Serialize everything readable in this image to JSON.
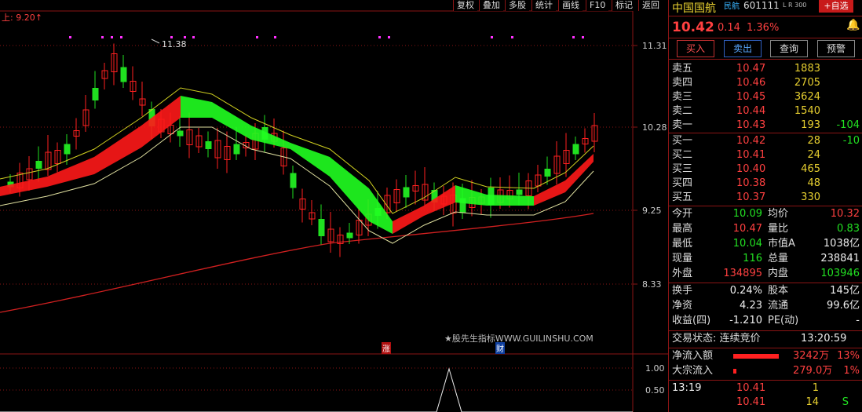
{
  "toolbar": {
    "items": [
      "复权",
      "叠加",
      "多股",
      "统计",
      "画线",
      "F10",
      "标记",
      "返回"
    ]
  },
  "chart_header": {
    "label": "上: 9.20",
    "arrow": "↑"
  },
  "chart_data": {
    "type": "line",
    "yticks": [
      "11.31",
      "10.28",
      "9.25",
      "8.33"
    ],
    "subticks": [
      "1.00",
      "0.50"
    ],
    "high_annotation": "11.38",
    "markers": {
      "zhang": "涨",
      "cai": "财"
    },
    "colors": {
      "up": "#ff2020",
      "down": "#20e020",
      "ma": "#d0d020",
      "long_ma": "#d02020"
    }
  },
  "watermark": "★股先生指标WWW.GUILINSHU.COM",
  "stock": {
    "name": "中国国航",
    "badge": "民航",
    "code": "601111",
    "lr": "L R 300",
    "add_button": "+自选",
    "price": "10.42",
    "change": "0.14",
    "pct": "1.36%",
    "bell_icon": "bell-icon"
  },
  "actions": {
    "buy": "买入",
    "sell": "卖出",
    "query": "查询",
    "alert": "预警"
  },
  "asks": [
    {
      "label": "卖五",
      "price": "10.47",
      "vol": "1883",
      "diff": ""
    },
    {
      "label": "卖四",
      "price": "10.46",
      "vol": "2705",
      "diff": ""
    },
    {
      "label": "卖三",
      "price": "10.45",
      "vol": "3624",
      "diff": ""
    },
    {
      "label": "卖二",
      "price": "10.44",
      "vol": "1540",
      "diff": ""
    },
    {
      "label": "卖一",
      "price": "10.43",
      "vol": "193",
      "diff": "-104"
    }
  ],
  "bids": [
    {
      "label": "买一",
      "price": "10.42",
      "vol": "28",
      "diff": "-10"
    },
    {
      "label": "买二",
      "price": "10.41",
      "vol": "24",
      "diff": ""
    },
    {
      "label": "买三",
      "price": "10.40",
      "vol": "465",
      "diff": ""
    },
    {
      "label": "买四",
      "price": "10.38",
      "vol": "48",
      "diff": ""
    },
    {
      "label": "买五",
      "price": "10.37",
      "vol": "330",
      "diff": ""
    }
  ],
  "stats": [
    {
      "l1": "今开",
      "v1": "10.09",
      "c1": "grn",
      "l2": "均价",
      "v2": "10.32",
      "c2": "red"
    },
    {
      "l1": "最高",
      "v1": "10.47",
      "c1": "red",
      "l2": "量比",
      "v2": "0.83",
      "c2": "grn"
    },
    {
      "l1": "最低",
      "v1": "10.04",
      "c1": "grn",
      "l2": "市值A",
      "v2": "1038亿",
      "c2": "wht"
    },
    {
      "l1": "现量",
      "v1": "116",
      "c1": "grn",
      "l2": "总量",
      "v2": "238841",
      "c2": "wht"
    },
    {
      "l1": "外盘",
      "v1": "134895",
      "c1": "red",
      "l2": "内盘",
      "v2": "103946",
      "c2": "grn"
    }
  ],
  "stats2": [
    {
      "l1": "换手",
      "v1": "0.24%",
      "l2": "股本",
      "v2": "145亿"
    },
    {
      "l1": "净资",
      "v1": "4.23",
      "l2": "流通",
      "v2": "99.6亿"
    },
    {
      "l1": "收益(四)",
      "v1": "-1.210",
      "l2": "PE(动)",
      "v2": "-"
    }
  ],
  "trade_status": {
    "label": "交易状态: 连续竞价",
    "time": "13:20:59"
  },
  "flows": [
    {
      "label": "净流入额",
      "value": "3242万",
      "pct": "13%",
      "bar": 0.9
    },
    {
      "label": "大宗流入",
      "value": "279.0万",
      "pct": "1%",
      "bar": 0.05
    }
  ],
  "ticks": [
    {
      "time": "13:19",
      "price": "10.41",
      "vol": "1",
      "flag": ""
    },
    {
      "time": "",
      "price": "10.41",
      "vol": "14",
      "flag": "S"
    }
  ]
}
